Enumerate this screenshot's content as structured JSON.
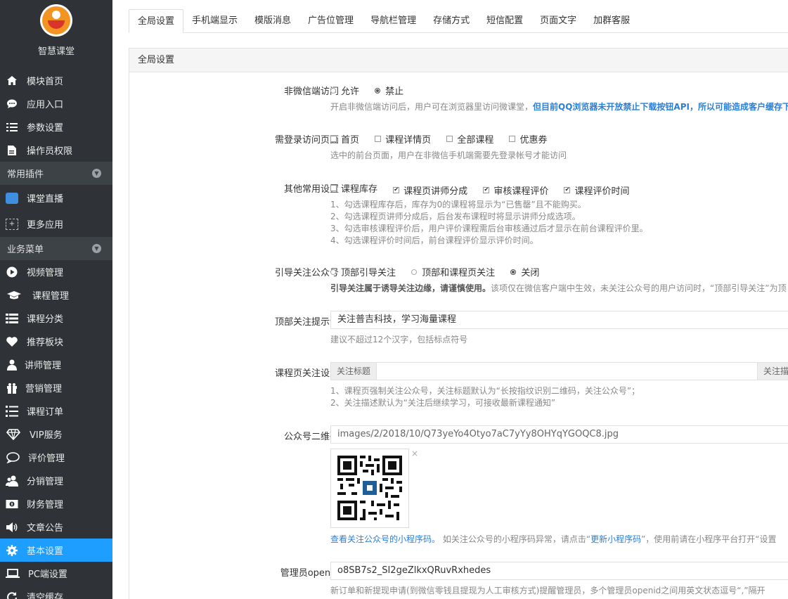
{
  "brand": {
    "name": "智慧课堂",
    "logo_colors": [
      "#f39321",
      "#d9342b"
    ]
  },
  "sidebar": {
    "top_items": [
      {
        "label": "模块首页",
        "icon": "home-icon"
      },
      {
        "label": "应用入口",
        "icon": "chat-icon"
      },
      {
        "label": "参数设置",
        "icon": "list-icon"
      },
      {
        "label": "操作员权限",
        "icon": "file-icon"
      }
    ],
    "group1": {
      "label": "常用插件"
    },
    "plugin_items": [
      {
        "label": "课堂直播",
        "icon": "live-icon"
      },
      {
        "label": "更多应用",
        "icon": "plus-box-icon"
      }
    ],
    "group2": {
      "label": "业务菜单"
    },
    "biz_items": [
      {
        "label": "视频管理",
        "icon": "play-icon"
      },
      {
        "label": "课程管理",
        "icon": "graduation-cap-icon"
      },
      {
        "label": "课程分类",
        "icon": "list-icon"
      },
      {
        "label": "推荐板块",
        "icon": "heart-icon"
      },
      {
        "label": "讲师管理",
        "icon": "teacher-icon"
      },
      {
        "label": "营销管理",
        "icon": "gift-icon"
      },
      {
        "label": "课程订单",
        "icon": "order-list-icon"
      },
      {
        "label": "VIP服务",
        "icon": "diamond-icon"
      },
      {
        "label": "评价管理",
        "icon": "comment-icon"
      },
      {
        "label": "分销管理",
        "icon": "users-icon"
      },
      {
        "label": "财务管理",
        "icon": "money-icon"
      },
      {
        "label": "文章公告",
        "icon": "megaphone-icon"
      },
      {
        "label": "基本设置",
        "icon": "gear-icon",
        "active": true
      },
      {
        "label": "PC端设置",
        "icon": "laptop-icon"
      },
      {
        "label": "清空缓存",
        "icon": "refresh-icon"
      }
    ],
    "active_color": "#1e9fff"
  },
  "tabs": [
    "全局设置",
    "手机端显示",
    "模版消息",
    "广告位管理",
    "导航栏管理",
    "存储方式",
    "短信配置",
    "页面文字",
    "加群客服"
  ],
  "panel": {
    "title": "全局设置"
  },
  "form": {
    "wechat_access": {
      "label": "非微信端访问",
      "options": [
        "允许",
        "禁止"
      ],
      "selected": "禁止",
      "help_plain": "开启非微信端访问后，用户可在浏览器里访问微课堂，",
      "help_blue": "但目前QQ浏览器未开放禁止下载按钮API，所以可能造成客户缓存下"
    },
    "login_pages": {
      "label": "需登录访问页面",
      "options": [
        "首页",
        "课程详情页",
        "全部课程",
        "优惠券"
      ],
      "help": "选中的前台页面，用户在非微信手机端需要先登录帐号才能访问"
    },
    "other_settings": {
      "label": "其他常用设置",
      "options": [
        {
          "label": "课程库存",
          "checked": false
        },
        {
          "label": "课程页讲师分成",
          "checked": true
        },
        {
          "label": "审核课程评价",
          "checked": true
        },
        {
          "label": "课程评价时间",
          "checked": true
        }
      ],
      "help": [
        "1、勾选课程库存后，库存为0的课程将显示为“已售罄”且不能购买。",
        "2、勾选课程页讲师分成后，后台发布课程时将显示讲师分成选项。",
        "3、勾选审核课程评价后，用户评价课程需后台审核通过后才显示在前台课程评价里。",
        "4、勾选课程评价时间后，前台课程评价显示评价时间。"
      ]
    },
    "follow_guide": {
      "label": "引导关注公众号",
      "options": [
        "顶部引导关注",
        "顶部和课程页关注",
        "关闭"
      ],
      "selected": "关闭",
      "help_bold": "引导关注属于诱导关注边缘，请谨慎使用。",
      "help_plain": "该项仅在微信客户端中生效，未关注公众号的用户访问时，“顶部引导关注”为顶"
    },
    "top_tip": {
      "label": "顶部关注提示语",
      "value": "关注普吉科技，学习海量课程",
      "help": "建议不超过12个汉字，包括标点符号"
    },
    "course_follow": {
      "label": "课程页关注设置",
      "addon_left": "关注标题",
      "addon_right": "关注描",
      "help": [
        "1、课程页强制关注公众号，关注标题默认为“长按指纹识别二维码，关注公众号”；",
        "2、关注描述默认为“关注后继续学习，可接收最新课程通知”"
      ]
    },
    "qrcode": {
      "label": "公众号二维码",
      "value": "images/2/2018/10/Q73yeYo4Otyo7aC7yYy8OHYqYGOQC8.jpg",
      "close": "×",
      "help_link1": "查看关注公众号的小程序码。",
      "help_plain1": " 如关注公众号的小程序码异常，请点击“",
      "help_link2": "更新小程序码",
      "help_plain2": "”，使用前请在小程序平台打开“设置"
    },
    "admin_openid": {
      "label": "管理员openid",
      "value": "o8SB7s2_SI2geZlkxQRuvRxhedes",
      "help": "新订单和新提现申请(到微信零钱且提现为人工审核方式)提醒管理员，多个管理员openid之间用英文状态逗号“,”隔开"
    }
  }
}
